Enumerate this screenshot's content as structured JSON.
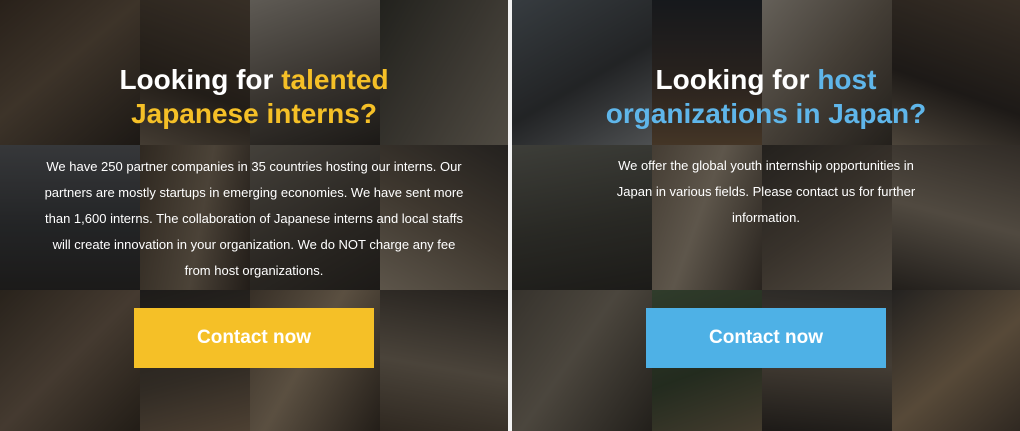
{
  "colors": {
    "accent_yellow": "#f5c027",
    "accent_blue": "#4eb1e6",
    "heading_blue": "#5fb6ea",
    "text": "#ffffff"
  },
  "left_panel": {
    "heading_prefix": "Looking for ",
    "heading_highlight_1": "talented",
    "heading_highlight_2": "Japanese interns?",
    "body": "We have 250 partner companies in 35 countries hosting our interns. Our partners are mostly startups in emerging economies. We have sent more than 1,600 interns. The collaboration of Japanese interns and local staffs will create innovation in your organization. We do NOT charge any fee from host organizations.",
    "button_label": "Contact now"
  },
  "right_panel": {
    "heading_prefix": "Looking for ",
    "heading_highlight_1": "host",
    "heading_highlight_2": "organizations in Japan?",
    "body": "We offer the global youth internship opportunities in Japan in various fields. Please contact us for further information.",
    "button_label": "Contact now"
  }
}
